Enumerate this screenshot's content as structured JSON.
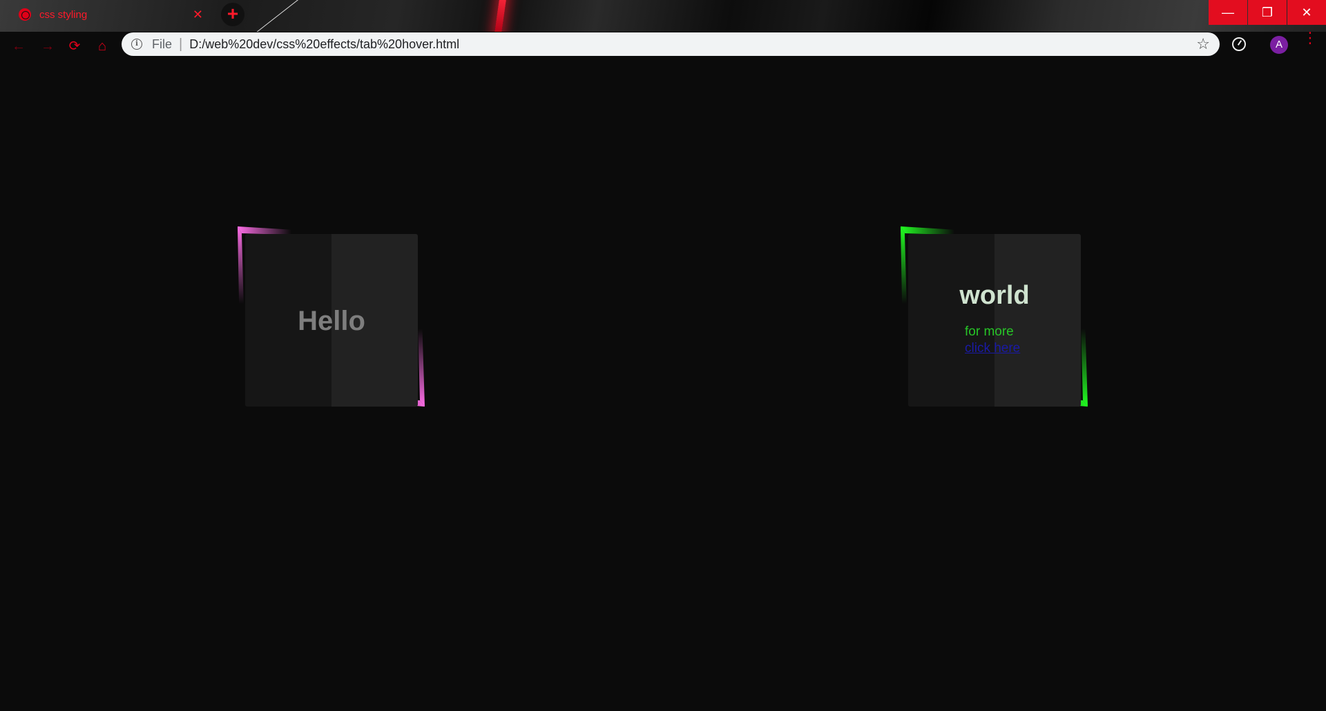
{
  "browser": {
    "tab_title": "css styling",
    "close_tab": "✕",
    "new_tab": "+",
    "scheme_label": "File",
    "url": "D:/web%20dev/css%20effects/tab%20hover.html",
    "avatar_letter": "A",
    "accent_color": "#e0001a"
  },
  "window_controls": {
    "minimize": "—",
    "restore": "❐",
    "close": "✕"
  },
  "cards": [
    {
      "heading": "Hello",
      "border_color": "#ff6ee8"
    },
    {
      "heading": "world",
      "subtext": "for more",
      "link_text": "click here",
      "border_color": "#22ff22"
    }
  ]
}
